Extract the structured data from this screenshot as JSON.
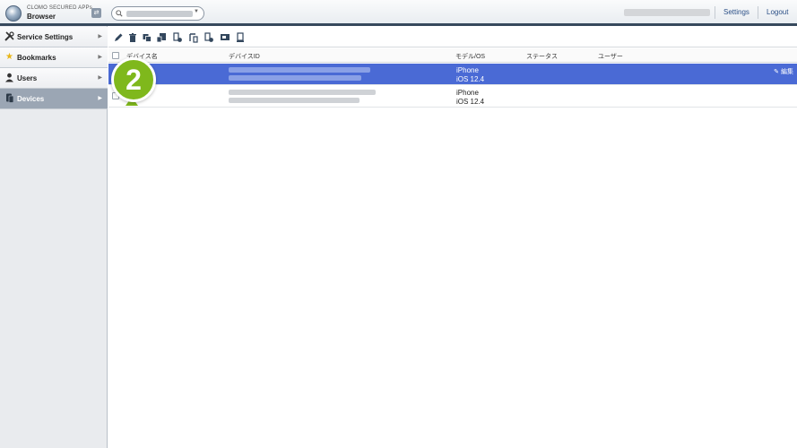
{
  "app": {
    "brand_line": "CLOMO SECURED APPs",
    "name": "Browser"
  },
  "header": {
    "settings_label": "Settings",
    "logout_label": "Logout"
  },
  "sidebar": {
    "items": [
      {
        "label": "Service Settings",
        "icon": "wrench-icon"
      },
      {
        "label": "Bookmarks",
        "icon": "star-icon"
      },
      {
        "label": "Users",
        "icon": "user-icon"
      },
      {
        "label": "Devices",
        "icon": "device-icon",
        "active": true
      }
    ]
  },
  "table": {
    "columns": [
      "デバイス名",
      "デバイスID",
      "モデル/OS",
      "ステータス",
      "ユーザー"
    ],
    "rows": [
      {
        "model": "iPhone",
        "os": "iOS 12.4",
        "selected": true
      },
      {
        "model": "iPhone",
        "os": "iOS 12.4",
        "selected": false
      }
    ],
    "edit_label": "編集"
  },
  "callout": {
    "number": "2"
  },
  "colors": {
    "selected_row": "#4a6ad5",
    "header_bar": "#37495d",
    "callout": "#7fb81c"
  }
}
